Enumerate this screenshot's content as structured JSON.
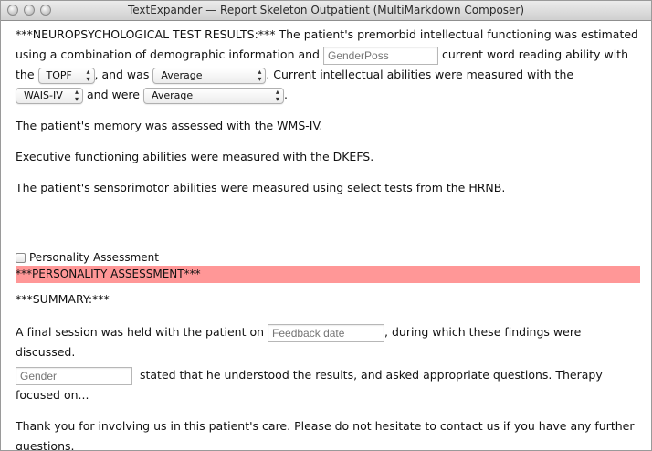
{
  "window": {
    "title": "TextExpander — Report Skeleton Outpatient (MultiMarkdown Composer)"
  },
  "p1": {
    "t1": "***NEUROPSYCHOLOGICAL TEST RESULTS:*** The patient's premorbid intellectual functioning was estimated using a combination of demographic information and",
    "gender_placeholder": "GenderPoss",
    "t2": "current word reading ability with the",
    "test_select": "TOPF",
    "t3": ", and was",
    "level_select": "Average",
    "t4": ". Current intellectual abilities were measured with the",
    "wais_select": "WAIS-IV",
    "t5": "and were",
    "were_select": "Average",
    "t6": "."
  },
  "memory": "The patient's memory was assessed with the WMS-IV.",
  "executive": "Executive functioning abilities were measured with the DKEFS.",
  "sensorimotor": "The patient's sensorimotor abilities were measured using select tests from the HRNB.",
  "personality": {
    "checkbox_label": "Personality Assessment",
    "heading": "***PERSONALITY ASSESSMENT***"
  },
  "summary": {
    "heading": "***SUMMARY:***",
    "s1": "A final session was held with the patient on",
    "feedback_placeholder": "Feedback date",
    "s2": ", during which these findings were discussed.",
    "gender_placeholder": "Gender",
    "s3": "stated that he understood the results, and asked appropriate questions. Therapy focused on..."
  },
  "closing": "Thank you for involving us in this patient's care. Please do not hesitate to contact us if you have any further questions."
}
